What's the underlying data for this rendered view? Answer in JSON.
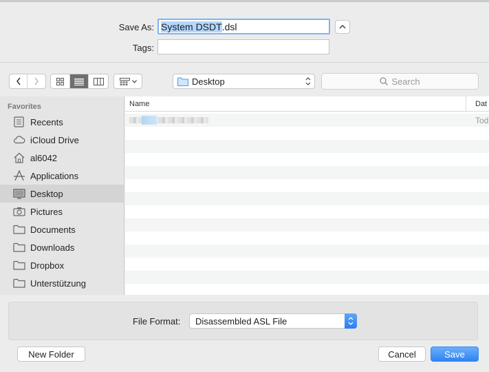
{
  "header": {
    "save_as_label": "Save As:",
    "filename_selected": "System DSDT",
    "filename_ext": ".dsl",
    "tags_label": "Tags:",
    "tags_value": ""
  },
  "toolbar": {
    "location": "Desktop",
    "search_placeholder": "Search"
  },
  "sidebar": {
    "heading": "Favorites",
    "items": [
      {
        "label": "Recents",
        "icon": "recents-icon"
      },
      {
        "label": "iCloud Drive",
        "icon": "cloud-icon"
      },
      {
        "label": "al6042",
        "icon": "home-icon"
      },
      {
        "label": "Applications",
        "icon": "applications-icon"
      },
      {
        "label": "Desktop",
        "icon": "desktop-icon",
        "selected": true
      },
      {
        "label": "Pictures",
        "icon": "camera-icon"
      },
      {
        "label": "Documents",
        "icon": "folder-icon"
      },
      {
        "label": "Downloads",
        "icon": "folder-icon"
      },
      {
        "label": "Dropbox",
        "icon": "folder-icon"
      },
      {
        "label": "Unterstützung",
        "icon": "folder-icon"
      }
    ]
  },
  "filelist": {
    "columns": {
      "name": "Name",
      "date": "Dat"
    },
    "rows": [
      {
        "date": "Tod"
      }
    ]
  },
  "options": {
    "format_label": "File Format:",
    "format_value": "Disassembled ASL File"
  },
  "buttons": {
    "new_folder": "New Folder",
    "cancel": "Cancel",
    "save": "Save"
  },
  "colors": {
    "accent": "#2f84f3",
    "selection": "#b3d7ff"
  }
}
